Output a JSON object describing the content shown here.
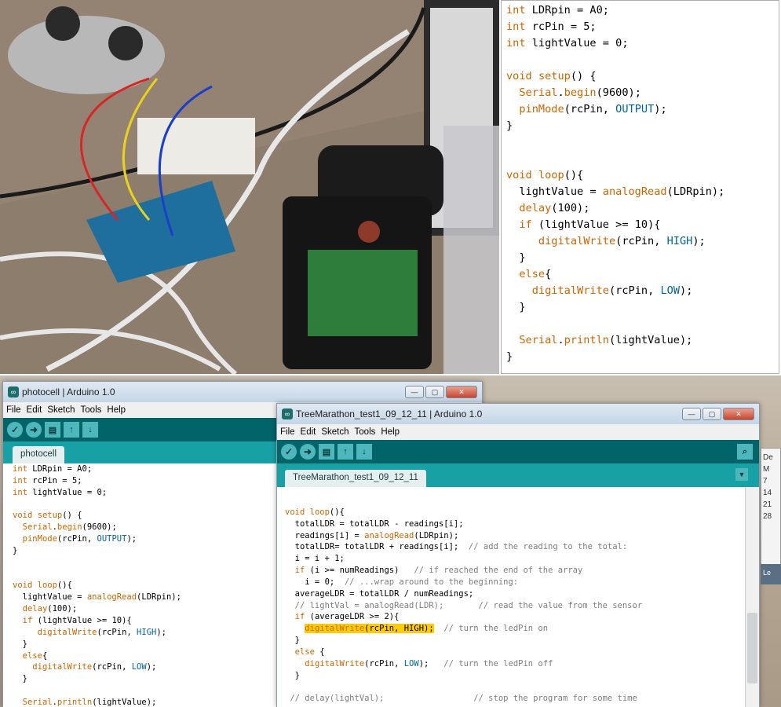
{
  "top_code": [
    [
      {
        "t": "int",
        "c": "ty"
      },
      {
        "t": " LDRpin = A0;"
      }
    ],
    [
      {
        "t": "int",
        "c": "ty"
      },
      {
        "t": " rcPin = 5;"
      }
    ],
    [
      {
        "t": "int",
        "c": "ty"
      },
      {
        "t": " lightValue = 0;"
      }
    ],
    [],
    [
      {
        "t": "void",
        "c": "ty"
      },
      {
        "t": " "
      },
      {
        "t": "setup",
        "c": "kw"
      },
      {
        "t": "() {"
      }
    ],
    [
      {
        "t": "  "
      },
      {
        "t": "Serial",
        "c": "kw"
      },
      {
        "t": "."
      },
      {
        "t": "begin",
        "c": "fn"
      },
      {
        "t": "(9600);"
      }
    ],
    [
      {
        "t": "  "
      },
      {
        "t": "pinMode",
        "c": "fn"
      },
      {
        "t": "(rcPin, "
      },
      {
        "t": "OUTPUT",
        "c": "ct"
      },
      {
        "t": ");"
      }
    ],
    [
      {
        "t": "}"
      }
    ],
    [],
    [],
    [
      {
        "t": "void",
        "c": "ty"
      },
      {
        "t": " "
      },
      {
        "t": "loop",
        "c": "kw"
      },
      {
        "t": "(){"
      }
    ],
    [
      {
        "t": "  lightValue = "
      },
      {
        "t": "analogRead",
        "c": "fn"
      },
      {
        "t": "(LDRpin);"
      }
    ],
    [
      {
        "t": "  "
      },
      {
        "t": "delay",
        "c": "fn"
      },
      {
        "t": "(100);"
      }
    ],
    [
      {
        "t": "  "
      },
      {
        "t": "if",
        "c": "kw"
      },
      {
        "t": " (lightValue >= 10){"
      }
    ],
    [
      {
        "t": "     "
      },
      {
        "t": "digitalWrite",
        "c": "fn"
      },
      {
        "t": "(rcPin, "
      },
      {
        "t": "HIGH",
        "c": "ct"
      },
      {
        "t": ");"
      }
    ],
    [
      {
        "t": "  }"
      }
    ],
    [
      {
        "t": "  "
      },
      {
        "t": "else",
        "c": "kw"
      },
      {
        "t": "{"
      }
    ],
    [
      {
        "t": "    "
      },
      {
        "t": "digitalWrite",
        "c": "fn"
      },
      {
        "t": "(rcPin, "
      },
      {
        "t": "LOW",
        "c": "ct"
      },
      {
        "t": ");"
      }
    ],
    [
      {
        "t": "  }"
      }
    ],
    [],
    [
      {
        "t": "  "
      },
      {
        "t": "Serial",
        "c": "kw"
      },
      {
        "t": "."
      },
      {
        "t": "println",
        "c": "fn"
      },
      {
        "t": "(lightValue);"
      }
    ],
    [
      {
        "t": "}"
      }
    ]
  ],
  "window_left": {
    "title": "photocell | Arduino 1.0",
    "menu": [
      "File",
      "Edit",
      "Sketch",
      "Tools",
      "Help"
    ],
    "tab": "photocell",
    "code": [
      [
        {
          "t": "int",
          "c": "ty"
        },
        {
          "t": " LDRpin = A0;"
        }
      ],
      [
        {
          "t": "int",
          "c": "ty"
        },
        {
          "t": " rcPin = 5;"
        }
      ],
      [
        {
          "t": "int",
          "c": "ty"
        },
        {
          "t": " lightValue = 0;"
        }
      ],
      [],
      [
        {
          "t": "void",
          "c": "ty"
        },
        {
          "t": " "
        },
        {
          "t": "setup",
          "c": "kw"
        },
        {
          "t": "() {"
        }
      ],
      [
        {
          "t": "  "
        },
        {
          "t": "Serial",
          "c": "kw"
        },
        {
          "t": "."
        },
        {
          "t": "begin",
          "c": "fn"
        },
        {
          "t": "(9600);"
        }
      ],
      [
        {
          "t": "  "
        },
        {
          "t": "pinMode",
          "c": "fn"
        },
        {
          "t": "(rcPin, "
        },
        {
          "t": "OUTPUT",
          "c": "ct"
        },
        {
          "t": ");"
        }
      ],
      [
        {
          "t": "}"
        }
      ],
      [],
      [],
      [
        {
          "t": "void",
          "c": "ty"
        },
        {
          "t": " "
        },
        {
          "t": "loop",
          "c": "kw"
        },
        {
          "t": "(){"
        }
      ],
      [
        {
          "t": "  lightValue = "
        },
        {
          "t": "analogRead",
          "c": "fn"
        },
        {
          "t": "(LDRpin);"
        }
      ],
      [
        {
          "t": "  "
        },
        {
          "t": "delay",
          "c": "fn"
        },
        {
          "t": "(100);"
        }
      ],
      [
        {
          "t": "  "
        },
        {
          "t": "if",
          "c": "kw"
        },
        {
          "t": " (lightValue >= 10){"
        }
      ],
      [
        {
          "t": "     "
        },
        {
          "t": "digitalWrite",
          "c": "fn"
        },
        {
          "t": "(rcPin, "
        },
        {
          "t": "HIGH",
          "c": "ct"
        },
        {
          "t": ");"
        }
      ],
      [
        {
          "t": "  }"
        }
      ],
      [
        {
          "t": "  "
        },
        {
          "t": "else",
          "c": "kw"
        },
        {
          "t": "{"
        }
      ],
      [
        {
          "t": "    "
        },
        {
          "t": "digitalWrite",
          "c": "fn"
        },
        {
          "t": "(rcPin, "
        },
        {
          "t": "LOW",
          "c": "ct"
        },
        {
          "t": ");"
        }
      ],
      [
        {
          "t": "  }"
        }
      ],
      [],
      [
        {
          "t": "  "
        },
        {
          "t": "Serial",
          "c": "kw"
        },
        {
          "t": "."
        },
        {
          "t": "println",
          "c": "fn"
        },
        {
          "t": "(lightValue);"
        }
      ]
    ]
  },
  "window_right": {
    "title": "TreeMarathon_test1_09_12_11 | Arduino 1.0",
    "menu": [
      "File",
      "Edit",
      "Sketch",
      "Tools",
      "Help"
    ],
    "tab": "TreeMarathon_test1_09_12_11",
    "code": [
      [],
      [
        {
          "t": "void",
          "c": "ty"
        },
        {
          "t": " "
        },
        {
          "t": "loop",
          "c": "kw"
        },
        {
          "t": "(){"
        }
      ],
      [
        {
          "t": "  totalLDR = totalLDR - readings[i];"
        }
      ],
      [
        {
          "t": "  readings[i] = "
        },
        {
          "t": "analogRead",
          "c": "fn"
        },
        {
          "t": "(LDRpin);"
        }
      ],
      [
        {
          "t": "  totalLDR= totalLDR + readings[i];  "
        },
        {
          "t": "// add the reading to the total:",
          "c": "cm"
        }
      ],
      [
        {
          "t": "  i = i + 1;"
        }
      ],
      [
        {
          "t": "  "
        },
        {
          "t": "if",
          "c": "kw"
        },
        {
          "t": " (i >= numReadings)   "
        },
        {
          "t": "// if reached the end of the array",
          "c": "cm"
        }
      ],
      [
        {
          "t": "    i = 0;  "
        },
        {
          "t": "// ...wrap around to the beginning:",
          "c": "cm"
        }
      ],
      [
        {
          "t": "  averageLDR = totalLDR / numReadings;"
        }
      ],
      [
        {
          "t": "  // lightVal = analogRead(LDR);       // read the value from the sensor",
          "c": "cm"
        }
      ],
      [
        {
          "t": "  "
        },
        {
          "t": "if",
          "c": "kw"
        },
        {
          "t": " (averageLDR >= 2){"
        }
      ],
      [
        {
          "t": "    "
        },
        {
          "t": "digitalWrite",
          "c": "fn hl"
        },
        {
          "t": "(rcPin, HIGH);",
          "c": "hl"
        },
        {
          "t": "  "
        },
        {
          "t": "// turn the ledPin on",
          "c": "cm"
        }
      ],
      [
        {
          "t": "  }"
        }
      ],
      [
        {
          "t": "  "
        },
        {
          "t": "else",
          "c": "kw"
        },
        {
          "t": " {"
        }
      ],
      [
        {
          "t": "    "
        },
        {
          "t": "digitalWrite",
          "c": "fn"
        },
        {
          "t": "(rcPin, "
        },
        {
          "t": "LOW",
          "c": "ct"
        },
        {
          "t": ");   "
        },
        {
          "t": "// turn the ledPin off",
          "c": "cm"
        }
      ],
      [
        {
          "t": "  }"
        }
      ],
      [],
      [
        {
          "t": " // delay(lightVal);                  // stop the program for some time",
          "c": "cm"
        }
      ]
    ]
  },
  "calendar": {
    "header": "De",
    "rows": [
      "M",
      "7",
      "14",
      "21",
      "28"
    ],
    "footer": "Le"
  }
}
